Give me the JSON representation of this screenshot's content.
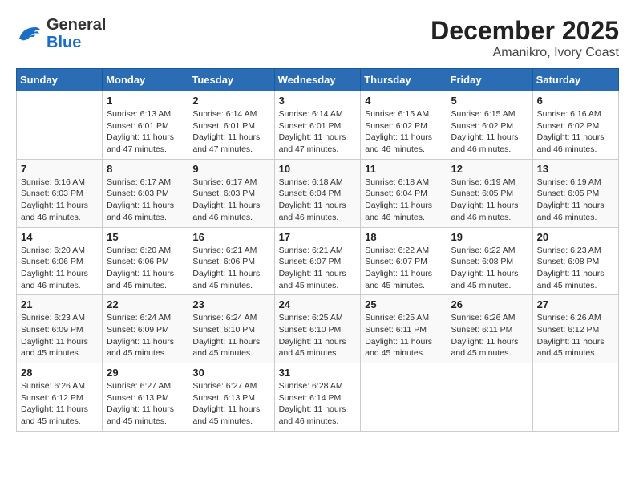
{
  "header": {
    "logo_line1": "General",
    "logo_line2": "Blue",
    "title": "December 2025",
    "subtitle": "Amanikro, Ivory Coast"
  },
  "calendar": {
    "days_of_week": [
      "Sunday",
      "Monday",
      "Tuesday",
      "Wednesday",
      "Thursday",
      "Friday",
      "Saturday"
    ],
    "weeks": [
      [
        {
          "day": "",
          "info": ""
        },
        {
          "day": "1",
          "info": "Sunrise: 6:13 AM\nSunset: 6:01 PM\nDaylight: 11 hours\nand 47 minutes."
        },
        {
          "day": "2",
          "info": "Sunrise: 6:14 AM\nSunset: 6:01 PM\nDaylight: 11 hours\nand 47 minutes."
        },
        {
          "day": "3",
          "info": "Sunrise: 6:14 AM\nSunset: 6:01 PM\nDaylight: 11 hours\nand 47 minutes."
        },
        {
          "day": "4",
          "info": "Sunrise: 6:15 AM\nSunset: 6:02 PM\nDaylight: 11 hours\nand 46 minutes."
        },
        {
          "day": "5",
          "info": "Sunrise: 6:15 AM\nSunset: 6:02 PM\nDaylight: 11 hours\nand 46 minutes."
        },
        {
          "day": "6",
          "info": "Sunrise: 6:16 AM\nSunset: 6:02 PM\nDaylight: 11 hours\nand 46 minutes."
        }
      ],
      [
        {
          "day": "7",
          "info": "Sunrise: 6:16 AM\nSunset: 6:03 PM\nDaylight: 11 hours\nand 46 minutes."
        },
        {
          "day": "8",
          "info": "Sunrise: 6:17 AM\nSunset: 6:03 PM\nDaylight: 11 hours\nand 46 minutes."
        },
        {
          "day": "9",
          "info": "Sunrise: 6:17 AM\nSunset: 6:03 PM\nDaylight: 11 hours\nand 46 minutes."
        },
        {
          "day": "10",
          "info": "Sunrise: 6:18 AM\nSunset: 6:04 PM\nDaylight: 11 hours\nand 46 minutes."
        },
        {
          "day": "11",
          "info": "Sunrise: 6:18 AM\nSunset: 6:04 PM\nDaylight: 11 hours\nand 46 minutes."
        },
        {
          "day": "12",
          "info": "Sunrise: 6:19 AM\nSunset: 6:05 PM\nDaylight: 11 hours\nand 46 minutes."
        },
        {
          "day": "13",
          "info": "Sunrise: 6:19 AM\nSunset: 6:05 PM\nDaylight: 11 hours\nand 46 minutes."
        }
      ],
      [
        {
          "day": "14",
          "info": "Sunrise: 6:20 AM\nSunset: 6:06 PM\nDaylight: 11 hours\nand 46 minutes."
        },
        {
          "day": "15",
          "info": "Sunrise: 6:20 AM\nSunset: 6:06 PM\nDaylight: 11 hours\nand 45 minutes."
        },
        {
          "day": "16",
          "info": "Sunrise: 6:21 AM\nSunset: 6:06 PM\nDaylight: 11 hours\nand 45 minutes."
        },
        {
          "day": "17",
          "info": "Sunrise: 6:21 AM\nSunset: 6:07 PM\nDaylight: 11 hours\nand 45 minutes."
        },
        {
          "day": "18",
          "info": "Sunrise: 6:22 AM\nSunset: 6:07 PM\nDaylight: 11 hours\nand 45 minutes."
        },
        {
          "day": "19",
          "info": "Sunrise: 6:22 AM\nSunset: 6:08 PM\nDaylight: 11 hours\nand 45 minutes."
        },
        {
          "day": "20",
          "info": "Sunrise: 6:23 AM\nSunset: 6:08 PM\nDaylight: 11 hours\nand 45 minutes."
        }
      ],
      [
        {
          "day": "21",
          "info": "Sunrise: 6:23 AM\nSunset: 6:09 PM\nDaylight: 11 hours\nand 45 minutes."
        },
        {
          "day": "22",
          "info": "Sunrise: 6:24 AM\nSunset: 6:09 PM\nDaylight: 11 hours\nand 45 minutes."
        },
        {
          "day": "23",
          "info": "Sunrise: 6:24 AM\nSunset: 6:10 PM\nDaylight: 11 hours\nand 45 minutes."
        },
        {
          "day": "24",
          "info": "Sunrise: 6:25 AM\nSunset: 6:10 PM\nDaylight: 11 hours\nand 45 minutes."
        },
        {
          "day": "25",
          "info": "Sunrise: 6:25 AM\nSunset: 6:11 PM\nDaylight: 11 hours\nand 45 minutes."
        },
        {
          "day": "26",
          "info": "Sunrise: 6:26 AM\nSunset: 6:11 PM\nDaylight: 11 hours\nand 45 minutes."
        },
        {
          "day": "27",
          "info": "Sunrise: 6:26 AM\nSunset: 6:12 PM\nDaylight: 11 hours\nand 45 minutes."
        }
      ],
      [
        {
          "day": "28",
          "info": "Sunrise: 6:26 AM\nSunset: 6:12 PM\nDaylight: 11 hours\nand 45 minutes."
        },
        {
          "day": "29",
          "info": "Sunrise: 6:27 AM\nSunset: 6:13 PM\nDaylight: 11 hours\nand 45 minutes."
        },
        {
          "day": "30",
          "info": "Sunrise: 6:27 AM\nSunset: 6:13 PM\nDaylight: 11 hours\nand 45 minutes."
        },
        {
          "day": "31",
          "info": "Sunrise: 6:28 AM\nSunset: 6:14 PM\nDaylight: 11 hours\nand 46 minutes."
        },
        {
          "day": "",
          "info": ""
        },
        {
          "day": "",
          "info": ""
        },
        {
          "day": "",
          "info": ""
        }
      ]
    ]
  }
}
